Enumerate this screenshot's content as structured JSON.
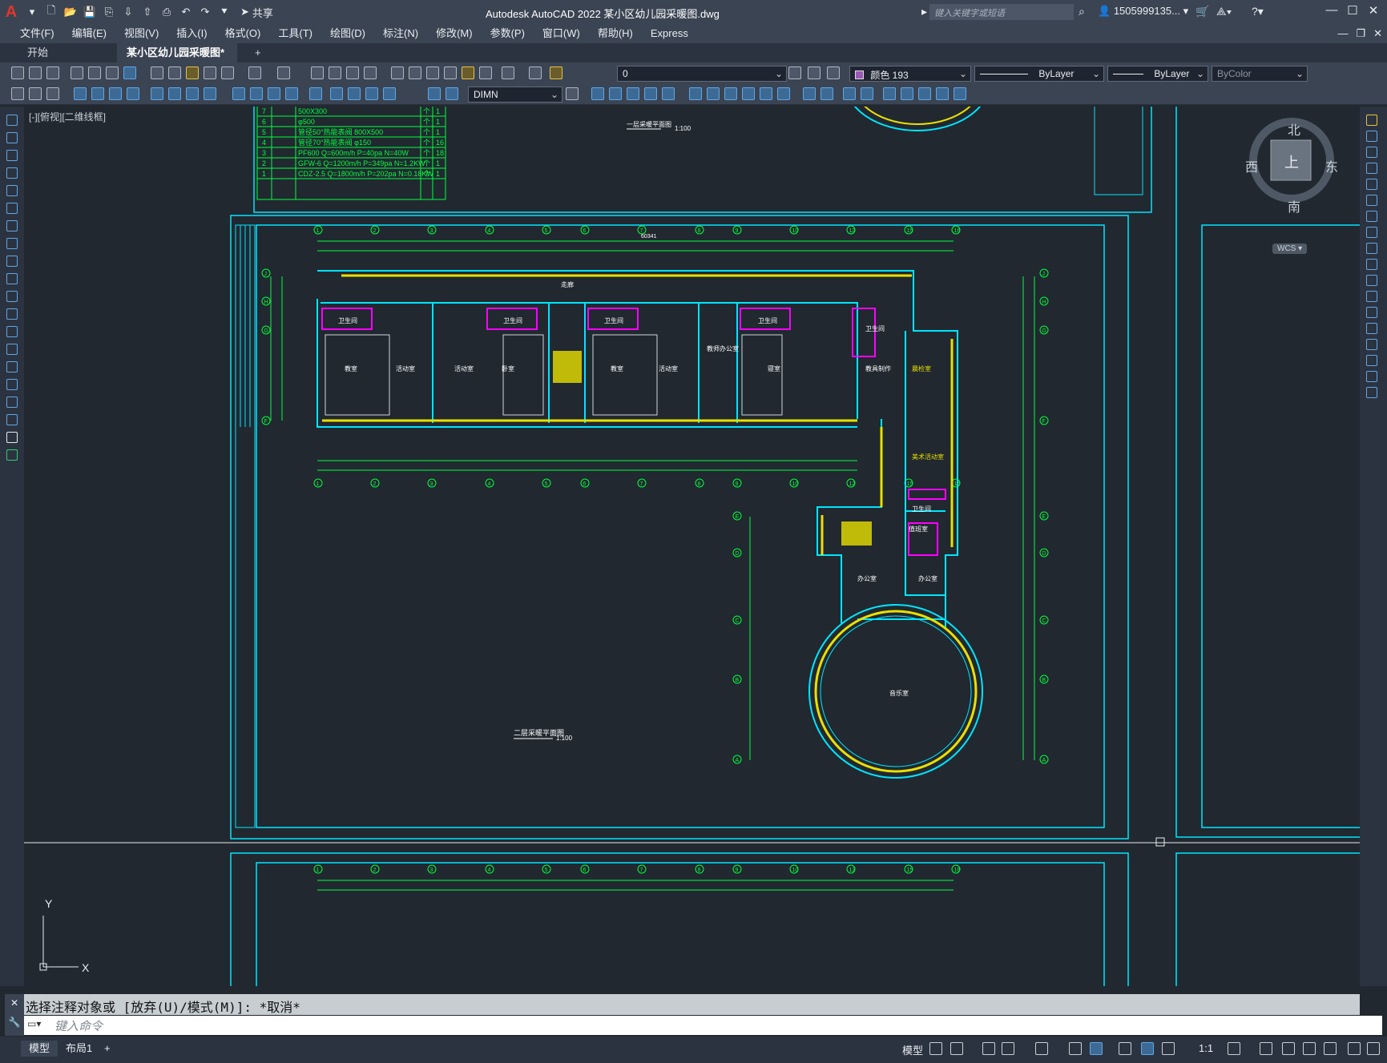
{
  "app": {
    "logo": "A",
    "title": "Autodesk AutoCAD 2022    某小区幼儿园采暖图.dwg",
    "share_label": "共享",
    "search_placeholder": "键入关键字或短语",
    "user": "1505999135...",
    "window_min": "—",
    "window_max": "☐",
    "window_close": "✕"
  },
  "menu": {
    "items": [
      "文件(F)",
      "编辑(E)",
      "视图(V)",
      "插入(I)",
      "格式(O)",
      "工具(T)",
      "绘图(D)",
      "标注(N)",
      "修改(M)",
      "参数(P)",
      "窗口(W)",
      "帮助(H)",
      "Express"
    ]
  },
  "tabs": {
    "start": "开始",
    "active": "某小区幼儿园采暖图*",
    "close": "×",
    "add": "+"
  },
  "toolbar": {
    "layer_value": "0",
    "color_value": "颜色 193",
    "linetype_value": "ByLayer",
    "lineweight_value": "ByLayer",
    "plotstyle_value": "ByColor",
    "dimstyle_value": "DIMN",
    "color_swatch": "#9b59b6"
  },
  "canvas": {
    "viewport_label": "[-][俯视][二维线框]",
    "viewcube": {
      "north": "北",
      "south": "南",
      "east": "东",
      "west": "西",
      "top": "上"
    },
    "wcs": "WCS",
    "ucs_y": "Y",
    "ucs_x": "X",
    "colors": {
      "background": "#212830",
      "frame": "#00e6ff",
      "grid": "#00ff3c",
      "pipe": "#e8e000",
      "fixture": "#ff00ff"
    },
    "legend_rows": [
      {
        "no": "7",
        "spec": "500X300",
        "unit": "个",
        "qty": "1"
      },
      {
        "no": "6",
        "spec": "φ500",
        "unit": "个",
        "qty": "1"
      },
      {
        "no": "5",
        "spec": "管径50°热能表阀  800X500",
        "unit": "个",
        "qty": "1"
      },
      {
        "no": "4",
        "spec": "管径70°热能表阀   φ150",
        "unit": "个",
        "qty": "16"
      },
      {
        "no": "3",
        "spec": "PF600 Q=600m/h P=40pa  N=40W",
        "unit": "个",
        "qty": "18"
      },
      {
        "no": "2",
        "spec": "GFW-6 Q=1200m/h P=349pa  N=1.2KW",
        "unit": "个",
        "qty": "1"
      },
      {
        "no": "1",
        "spec": "CDZ-2.5 Q=1800m/h P=202pa  N=0.18KW",
        "unit": "个",
        "qty": "1"
      }
    ],
    "plan_title_1": "一层采暖平面图",
    "plan_title_2": "二层采暖平面图",
    "scale": "1:100",
    "room_labels": [
      "走廊",
      "教室",
      "活动室",
      "活动室",
      "卧室",
      "教室",
      "卫生间",
      "卫生间",
      "卫生间",
      "卫生间",
      "教师办公室",
      "寝室",
      "活动室",
      "卫生间",
      "教具制作",
      "晨检室",
      "美术活动室",
      "办公室",
      "办公室",
      "音乐室",
      "卫生间",
      "值班室"
    ],
    "axis_top": [
      "1",
      "2",
      "3",
      "4",
      "5",
      "6",
      "7",
      "8",
      "9",
      "10",
      "12",
      "15",
      "16"
    ],
    "axis_side": [
      "J",
      "H",
      "G",
      "F",
      "E",
      "D",
      "C",
      "B",
      "A"
    ],
    "dim_total": "60341"
  },
  "command": {
    "history": "选择注释对象或 [放弃(U)/模式(M)]: *取消*",
    "input_placeholder": "键入命令"
  },
  "status": {
    "layout_model": "模型",
    "layout_1": "布局1",
    "add": "+",
    "model_label": "模型",
    "scale": "1:1"
  }
}
